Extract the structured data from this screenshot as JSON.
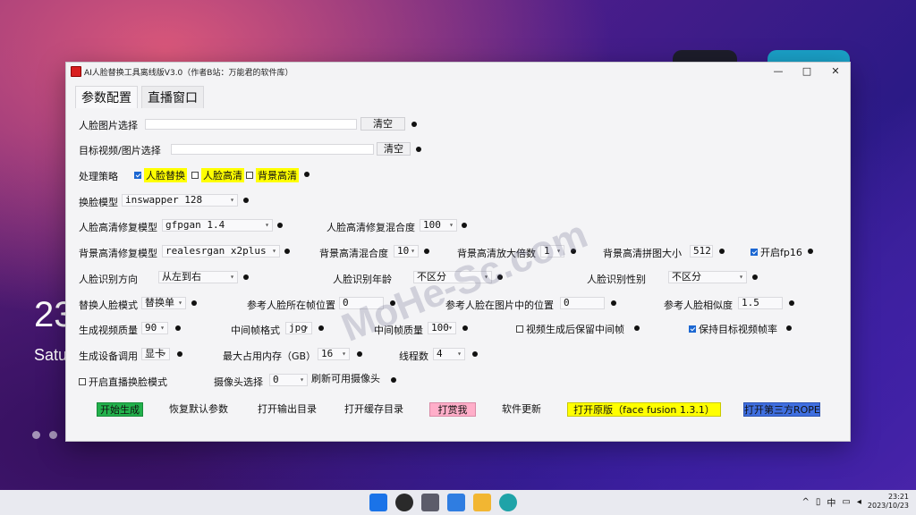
{
  "desktop": {
    "time_partial": "23",
    "date_partial": "Satu"
  },
  "window": {
    "title": "AI人脸替换工具离线版V3.0（作者B站：万能君的软件库）",
    "controls": {
      "minimize": "—",
      "maximize": "□",
      "close": "✕"
    }
  },
  "tabs": [
    {
      "label": "参数配置"
    },
    {
      "label": "直播窗口"
    }
  ],
  "form": {
    "face_image_label": "人脸图片选择",
    "face_image_clear": "清空",
    "target_label": "目标视频/图片选择",
    "target_clear": "清空",
    "strategy_label": "处理策略",
    "strategy_options": [
      "人脸替换",
      "人脸高清",
      "背景高清"
    ],
    "swap_model_label": "换脸模型",
    "swap_model_value": "inswapper 128",
    "face_restore_label": "人脸高清修复模型",
    "face_restore_value": "gfpgan 1.4",
    "face_restore_blend_label": "人脸高清修复混合度",
    "face_restore_blend_value": "100",
    "bg_restore_label": "背景高清修复模型",
    "bg_restore_value": "realesrgan x2plus",
    "bg_blend_label": "背景高清混合度",
    "bg_blend_value": "10",
    "bg_scale_label": "背景高清放大倍数",
    "bg_scale_value": "1",
    "bg_tile_label": "背景高清拼图大小",
    "bg_tile_value": "512",
    "fp16_label": "开启fp16",
    "face_direction_label": "人脸识别方向",
    "face_direction_value": "从左到右",
    "face_age_label": "人脸识别年龄",
    "face_age_value": "不区分",
    "face_gender_label": "人脸识别性别",
    "face_gender_value": "不区分",
    "replace_mode_label": "替换人脸模式",
    "replace_mode_value": "替换单",
    "ref_frame_label": "参考人脸所在帧位置",
    "ref_frame_value": "0",
    "ref_pos_label": "参考人脸在图片中的位置",
    "ref_pos_value": "0",
    "ref_sim_label": "参考人脸相似度",
    "ref_sim_value": "1.5",
    "video_quality_label": "生成视频质量",
    "video_quality_value": "90",
    "frame_format_label": "中间帧格式",
    "frame_format_value": "jpg",
    "frame_quality_label": "中间帧质量",
    "frame_quality_value": "100",
    "keep_frames_label": "视频生成后保留中间帧",
    "keep_fps_label": "保持目标视频帧率",
    "device_label": "生成设备调用",
    "device_value": "显卡",
    "max_mem_label": "最大占用内存（GB）",
    "max_mem_value": "16",
    "threads_label": "线程数",
    "threads_value": "4",
    "live_mode_label": "开启直播换脸模式",
    "camera_label": "摄像头选择",
    "camera_value": "0",
    "refresh_camera": "刷新可用摄像头"
  },
  "buttons": {
    "start": "开始生成",
    "reset": "恢复默认参数",
    "open_output": "打开输出目录",
    "open_cache": "打开缓存目录",
    "reward": "打赏我",
    "update": "软件更新",
    "open_original": "打开原版（face fusion 1.3.1）",
    "open_rope": "打开第三方ROPE"
  },
  "colors": {
    "start_green": "#22b14c",
    "reward_pink": "#ffaec9",
    "original_yellow": "#ffff00",
    "rope_blue": "#3f6fe0",
    "highlight_yellow": "#ffff00",
    "checked_blue": "#1b67d2"
  },
  "watermark": "MoHe-Sc.com",
  "taskbar": {
    "tray_lang": "中",
    "time": "23:21",
    "date": "2023/10/23"
  }
}
